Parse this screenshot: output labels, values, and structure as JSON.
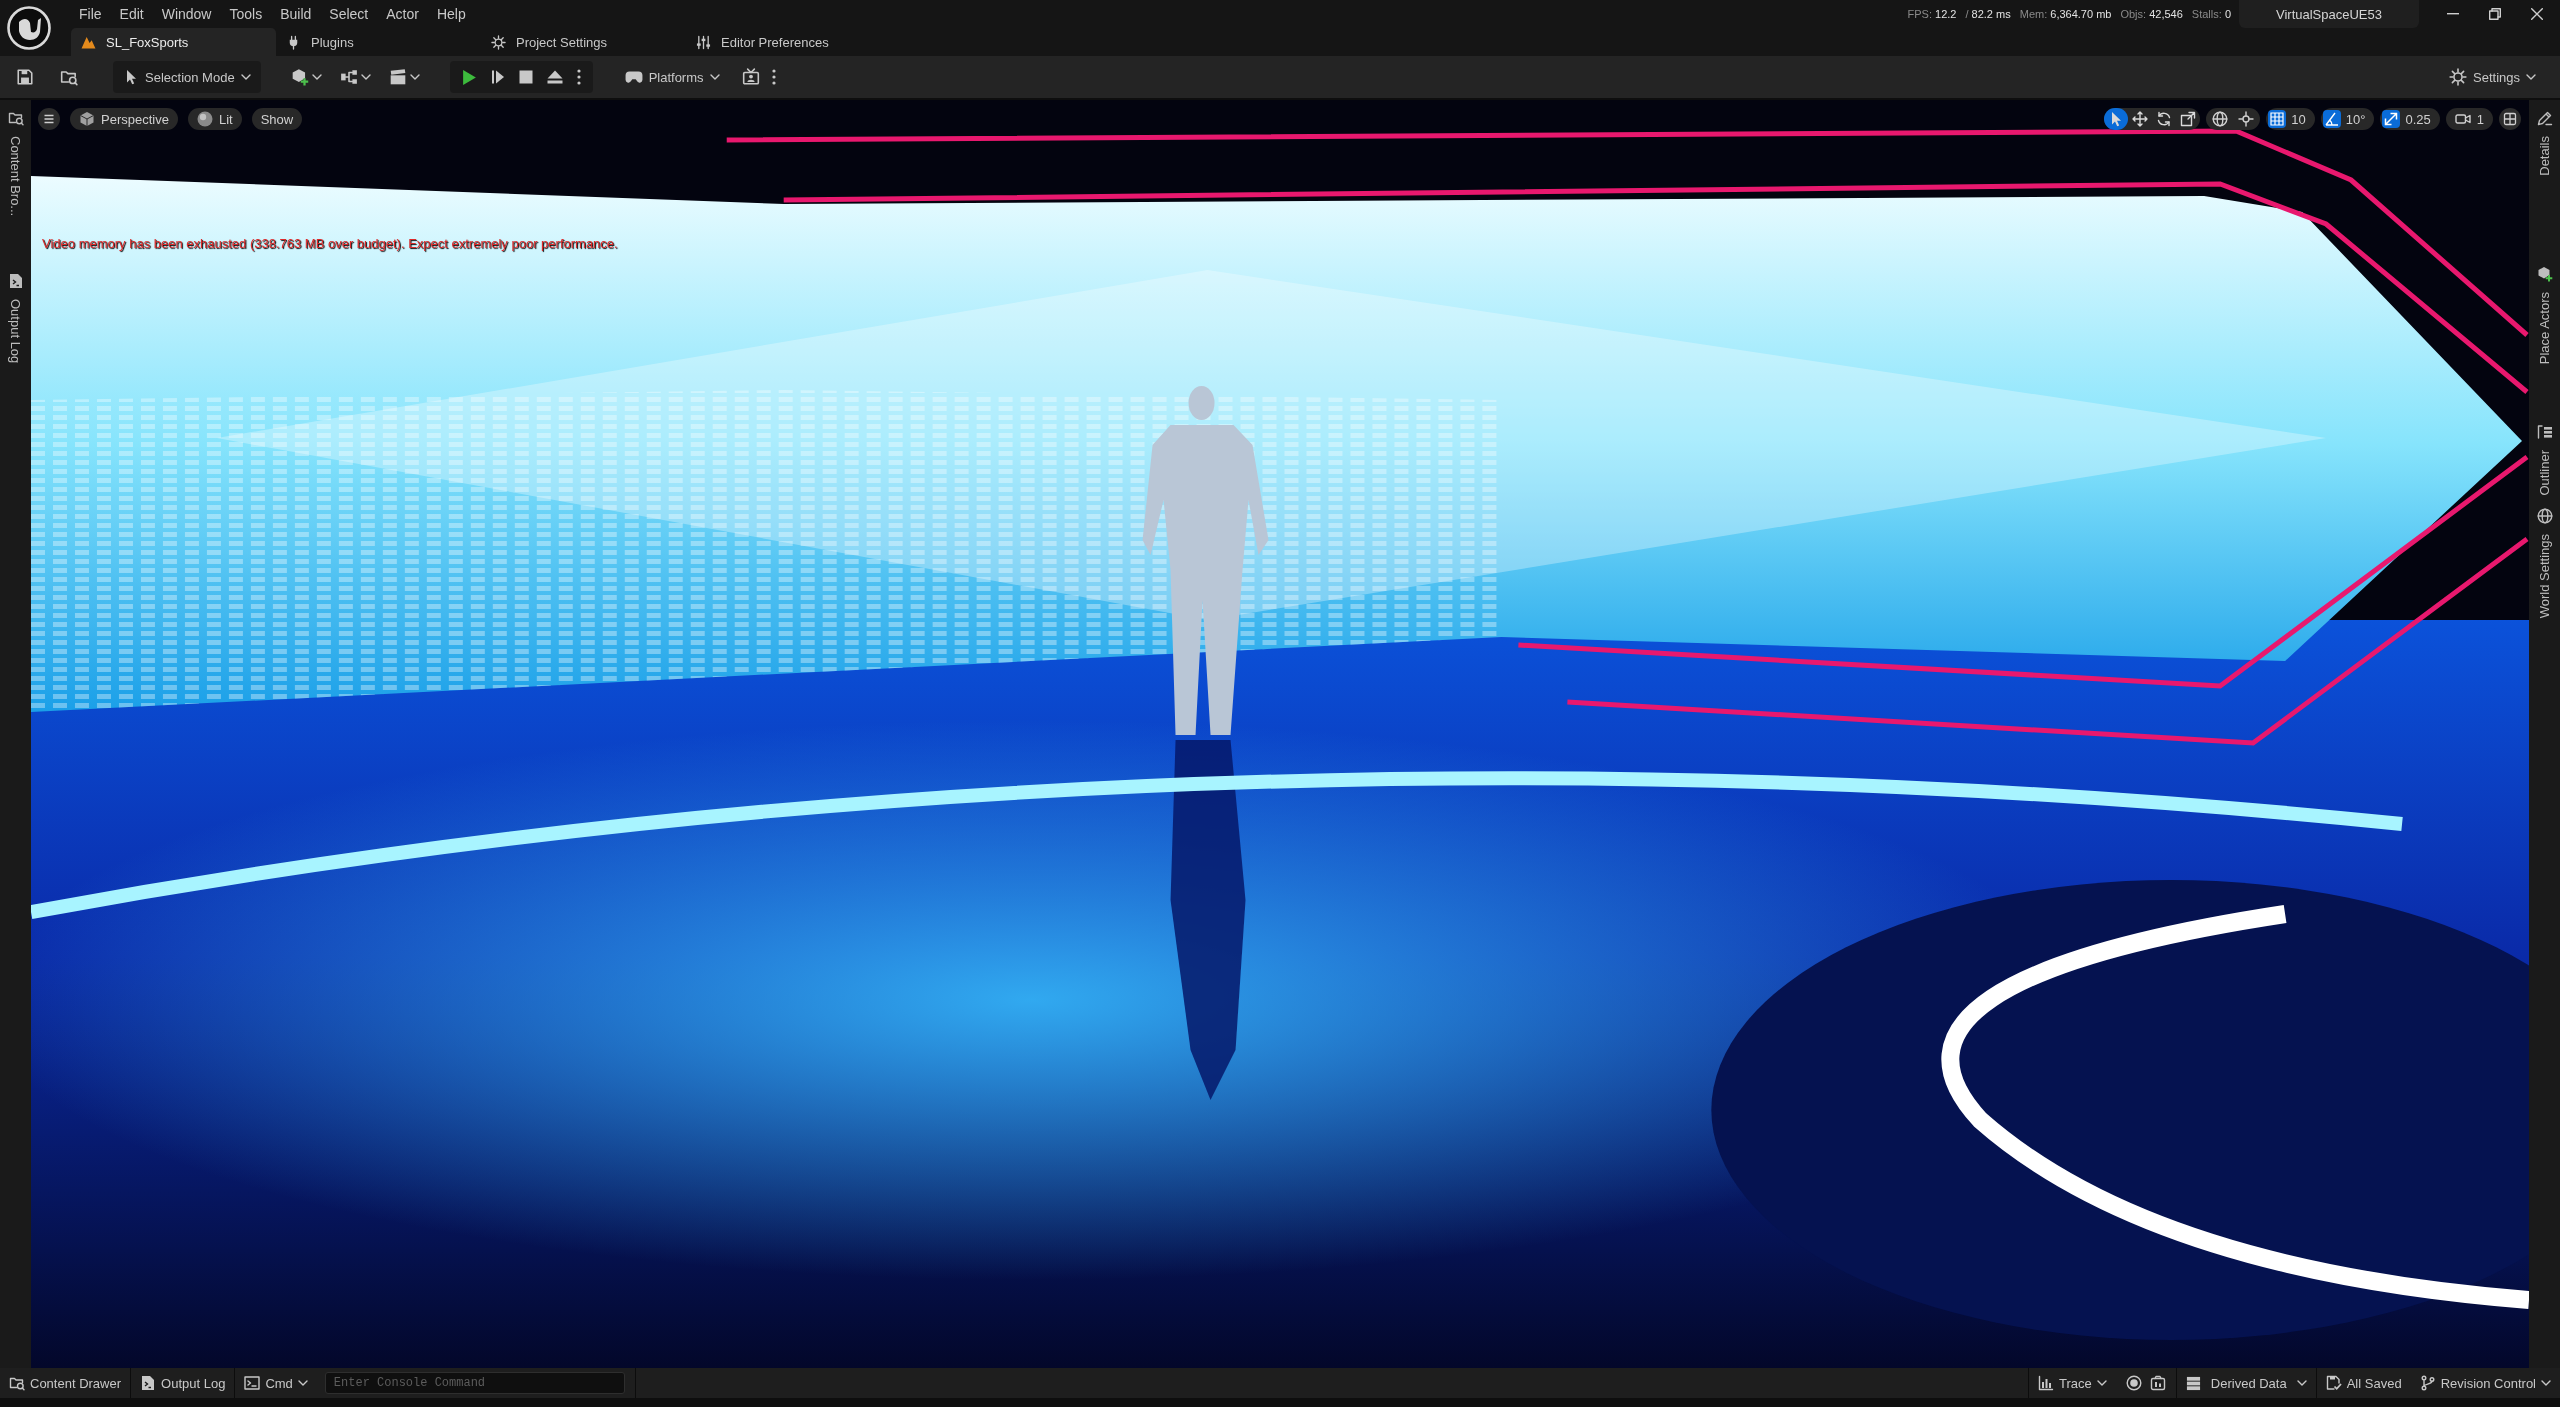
{
  "menu": [
    "File",
    "Edit",
    "Window",
    "Tools",
    "Build",
    "Select",
    "Actor",
    "Help"
  ],
  "stats": [
    {
      "label": "FPS:",
      "value": "12.2"
    },
    {
      "label": "/",
      "value": "82.2 ms"
    },
    {
      "label": "Mem:",
      "value": "6,364.70 mb"
    },
    {
      "label": "Objs:",
      "value": "42,546"
    },
    {
      "label": "Stalls:",
      "value": "0"
    }
  ],
  "project": "VirtualSpaceUE53",
  "tabs": [
    {
      "label": "SL_FoxSports",
      "kind": "level",
      "selected": true
    },
    {
      "label": "Plugins",
      "kind": "plugins",
      "selected": false
    },
    {
      "label": "Project Settings",
      "kind": "project",
      "selected": false
    },
    {
      "label": "Editor Preferences",
      "kind": "preferences",
      "selected": false
    }
  ],
  "toolbar": {
    "mode": "Selection Mode",
    "platforms": "Platforms",
    "settings": "Settings"
  },
  "left_sidebar": [
    {
      "label": "Content Bro...",
      "kind": "content"
    },
    {
      "label": "Output Log",
      "kind": "log"
    }
  ],
  "viewport": {
    "view_buttons": [
      {
        "label": "Perspective",
        "kind": "perspective"
      },
      {
        "label": "Lit",
        "kind": "lit"
      },
      {
        "label": "Show",
        "kind": "show"
      }
    ],
    "transform_tools": [
      {
        "kind": "select",
        "selected": true
      },
      {
        "kind": "move",
        "selected": false
      },
      {
        "kind": "rotate",
        "selected": false
      },
      {
        "kind": "scale",
        "selected": false
      }
    ],
    "snaps": [
      {
        "kind": "grid",
        "value": "10",
        "on": true
      },
      {
        "kind": "angle",
        "value": "10°",
        "on": true
      },
      {
        "kind": "scale",
        "value": "0.25",
        "on": true
      }
    ],
    "camera_speed": "1",
    "warning": "Video memory has been exhausted (338.763 MB over budget). Expect extremely poor performance."
  },
  "right_sidebar": [
    {
      "label": "Details",
      "kind": "details"
    },
    {
      "label": "Place Actors",
      "kind": "place"
    },
    {
      "label": "Outliner",
      "kind": "outliner"
    },
    {
      "label": "World Settings",
      "kind": "world"
    }
  ],
  "status_bar": {
    "left": [
      {
        "label": "Content Drawer",
        "kind": "drawer"
      },
      {
        "label": "Output Log",
        "kind": "log"
      }
    ],
    "command": {
      "label": "Cmd",
      "placeholder": "Enter Console Command"
    },
    "right": [
      {
        "label": "Trace",
        "kind": "trace"
      },
      {
        "label": "Derived Data",
        "kind": "ddc"
      },
      {
        "label": "All Saved",
        "kind": "saved"
      },
      {
        "label": "Revision Control",
        "kind": "revision"
      }
    ]
  }
}
